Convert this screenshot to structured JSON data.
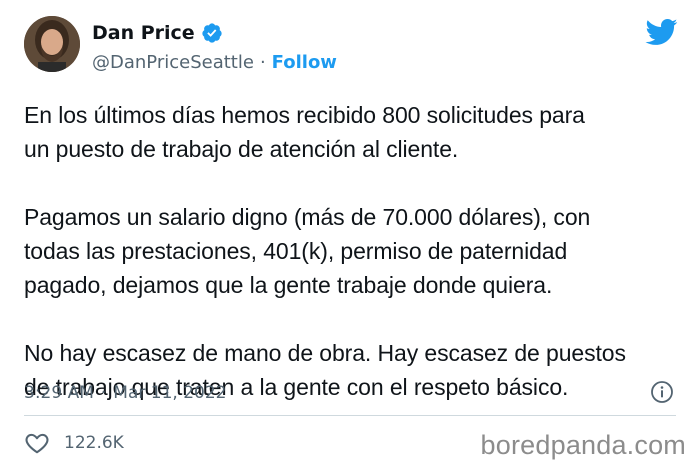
{
  "author": {
    "display_name": "Dan Price",
    "handle": "@DanPriceSeattle",
    "separator": "·",
    "follow_label": "Follow",
    "verified_icon": "verified-badge-icon",
    "verified_color": "#1d9bf0"
  },
  "brand": {
    "icon": "twitter-bird-icon",
    "color": "#1d9bf0"
  },
  "tweet": {
    "paragraphs": [
      "En los últimos días hemos recibido 800 solicitudes para\nun puesto de trabajo de atención al cliente.",
      "Pagamos un salario digno (más de 70.000 dólares), con\ntodas las prestaciones, 401(k), permiso de paternidad\npagado, dejamos que la gente trabaje donde quiera.",
      "No hay escasez de mano de obra. Hay escasez de puestos\nde trabajo que traten a la gente con el respeto básico."
    ]
  },
  "meta": {
    "time": "3:29 AM",
    "separator": "·",
    "date": "Mar 11, 2022",
    "info_icon": "info-icon"
  },
  "engagement": {
    "like_icon": "heart-icon",
    "likes": "122.6K"
  },
  "watermark": {
    "text": "boredpanda.com"
  }
}
